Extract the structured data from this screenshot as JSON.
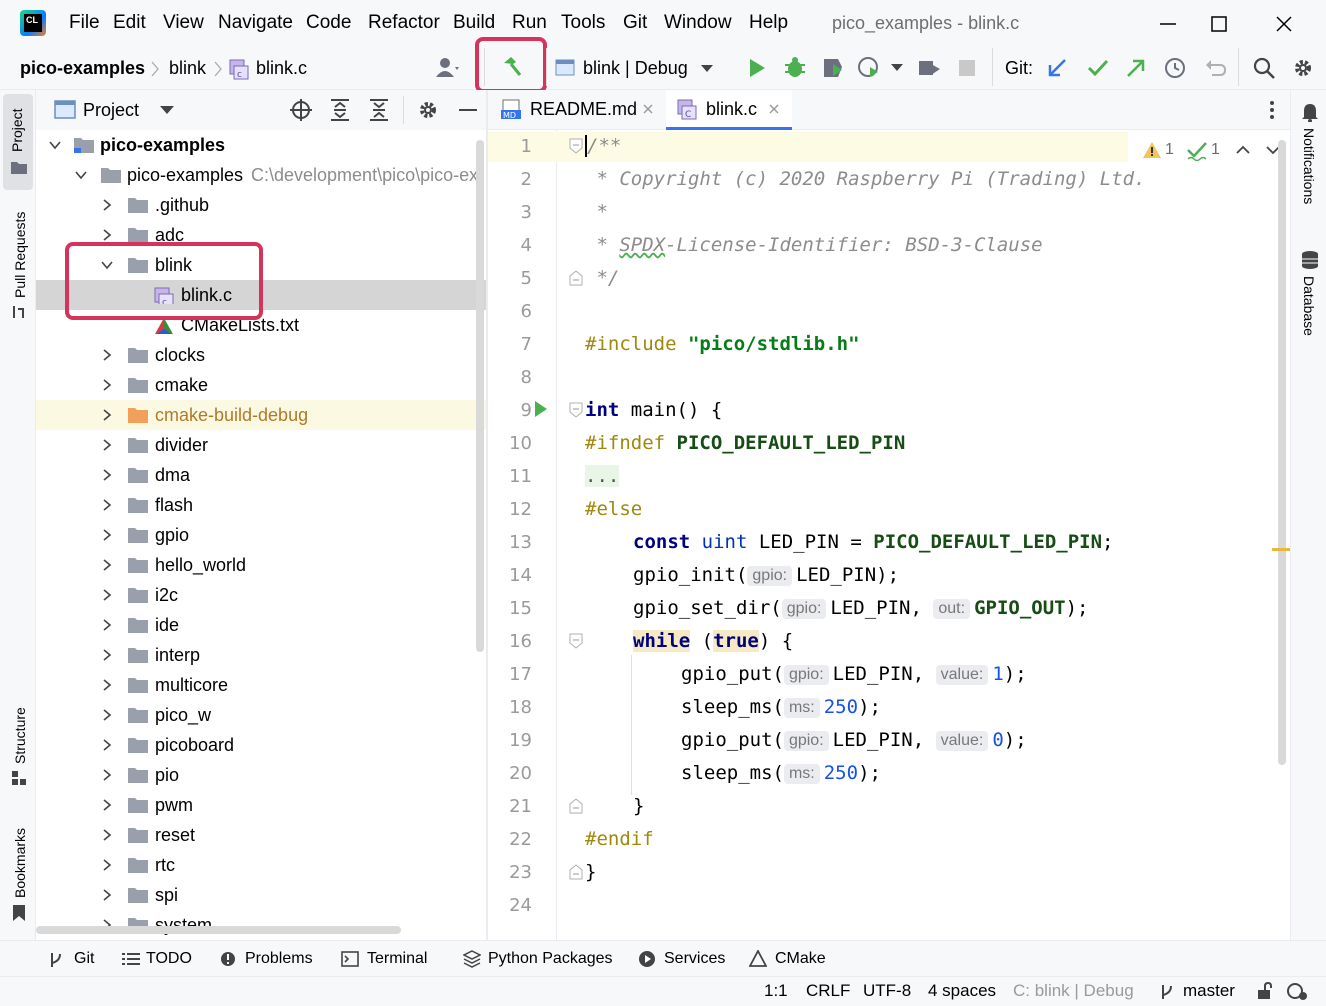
{
  "menu": {
    "file": "File",
    "edit": "Edit",
    "view": "View",
    "navigate": "Navigate",
    "code": "Code",
    "refactor": "Refactor",
    "build": "Build",
    "run": "Run",
    "tools": "Tools",
    "git": "Git",
    "window": "Window",
    "help": "Help"
  },
  "window_title": "pico_examples - blink.c",
  "breadcrumb": {
    "project": "pico-examples",
    "folder": "blink",
    "file": "blink.c"
  },
  "run_config": "blink | Debug",
  "git_label": "Git:",
  "left_stripe": {
    "project": "Project",
    "pull_requests": "Pull Requests",
    "structure": "Structure",
    "bookmarks": "Bookmarks"
  },
  "right_stripe": {
    "notifications": "Notifications",
    "database": "Database"
  },
  "project_panel": {
    "title": "Project"
  },
  "tree": {
    "root": "pico-examples",
    "child": "pico-examples",
    "child_path": "C:\\development\\pico\\pico-ex",
    "items": [
      {
        "label": ".github"
      },
      {
        "label": "adc"
      },
      {
        "label": "blink"
      },
      {
        "label": "blink.c"
      },
      {
        "label": "CMakeLists.txt"
      },
      {
        "label": "clocks"
      },
      {
        "label": "cmake"
      },
      {
        "label": "cmake-build-debug"
      },
      {
        "label": "divider"
      },
      {
        "label": "dma"
      },
      {
        "label": "flash"
      },
      {
        "label": "gpio"
      },
      {
        "label": "hello_world"
      },
      {
        "label": "i2c"
      },
      {
        "label": "ide"
      },
      {
        "label": "interp"
      },
      {
        "label": "multicore"
      },
      {
        "label": "pico_w"
      },
      {
        "label": "picoboard"
      },
      {
        "label": "pio"
      },
      {
        "label": "pwm"
      },
      {
        "label": "reset"
      },
      {
        "label": "rtc"
      },
      {
        "label": "spi"
      },
      {
        "label": "system"
      }
    ]
  },
  "editor_tabs": [
    {
      "label": "README.md",
      "badge": "MD"
    },
    {
      "label": "blink.c",
      "badge": "C"
    }
  ],
  "inspections": {
    "warnings": "1",
    "ok": "1"
  },
  "code": {
    "lines": [
      "1",
      "2",
      "3",
      "4",
      "5",
      "6",
      "7",
      "8",
      "9",
      "10",
      "11",
      "12",
      "13",
      "14",
      "15",
      "16",
      "17",
      "18",
      "19",
      "20",
      "21",
      "22",
      "23",
      "24"
    ],
    "l1": "/**",
    "l2": " * Copyright (c) 2020 Raspberry Pi (Trading) Ltd.",
    "l3": " *",
    "l4_a": " * ",
    "l4_b": "SPDX",
    "l4_c": "-License-Identifier: BSD-3-Clause",
    "l5": " */",
    "l7_a": "#include ",
    "l7_b": "\"pico/stdlib.h\"",
    "l9_a": "int",
    "l9_b": " main() {",
    "l10_a": "#ifndef ",
    "l10_b": "PICO_DEFAULT_LED_PIN",
    "l11": "...",
    "l12": "#else",
    "l13_a": "const",
    "l13_b": " uint",
    "l13_c": " LED_PIN = ",
    "l13_d": "PICO_DEFAULT_LED_PIN",
    "l13_e": ";",
    "l14_a": "gpio_init(",
    "l14_h": "gpio:",
    "l14_b": "LED_PIN);",
    "l15_a": "gpio_set_dir(",
    "l15_h1": "gpio:",
    "l15_b": "LED_PIN, ",
    "l15_h2": "out:",
    "l15_c": "GPIO_OUT",
    "l15_d": ");",
    "l16_a": "while",
    "l16_b": " (",
    "l16_c": "true",
    "l16_d": ") {",
    "l17_a": "gpio_put(",
    "l17_h1": "gpio:",
    "l17_b": "LED_PIN, ",
    "l17_h2": "value:",
    "l17_c": "1",
    "l17_d": ");",
    "l18_a": "sleep_ms(",
    "l18_h": "ms:",
    "l18_b": "250",
    "l18_c": ");",
    "l19_a": "gpio_put(",
    "l19_h1": "gpio:",
    "l19_b": "LED_PIN, ",
    "l19_h2": "value:",
    "l19_c": "0",
    "l19_d": ");",
    "l20_a": "sleep_ms(",
    "l20_h": "ms:",
    "l20_b": "250",
    "l20_c": ");",
    "l21": "}",
    "l22": "#endif",
    "l23": "}"
  },
  "tool_windows": {
    "git": "Git",
    "todo": "TODO",
    "problems": "Problems",
    "terminal": "Terminal",
    "python_packages": "Python Packages",
    "services": "Services",
    "cmake": "CMake"
  },
  "status": {
    "position": "1:1",
    "line_sep": "CRLF",
    "encoding": "UTF-8",
    "indent": "4 spaces",
    "context": "C: blink | Debug",
    "branch": "master"
  },
  "colors": {
    "accent": "#3574f0",
    "highlight_box": "#d6335a",
    "run_green": "#4caf50"
  }
}
